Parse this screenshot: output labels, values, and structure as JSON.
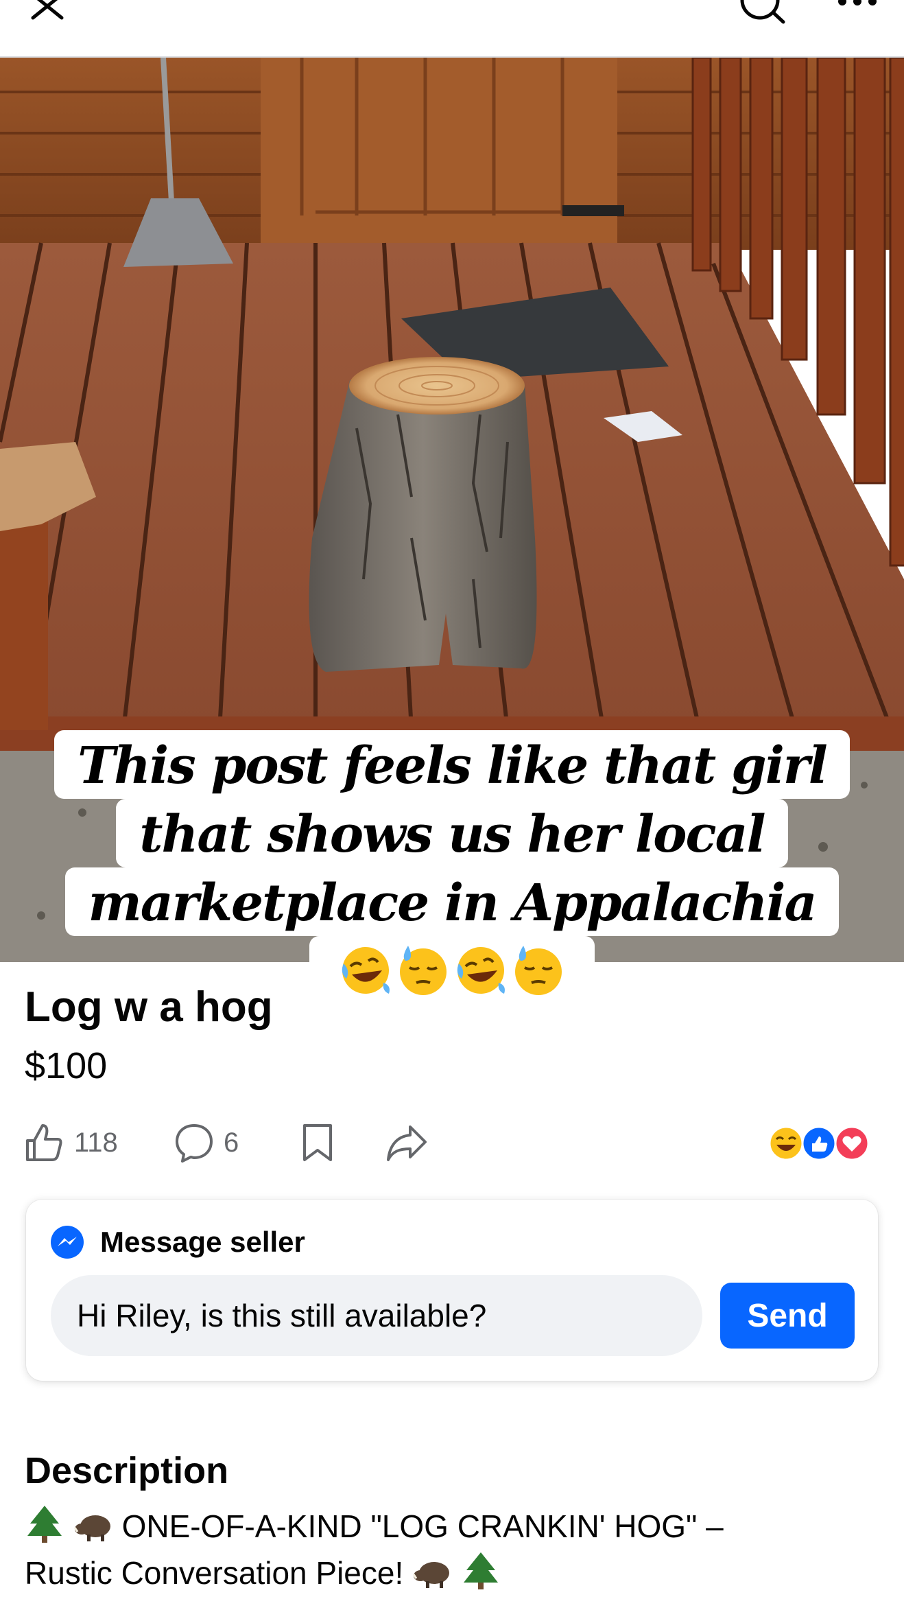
{
  "topbar": {
    "close_icon": "close-icon",
    "search_icon": "search-icon",
    "more_icon": "more-icon"
  },
  "photo": {
    "description_hidden": ""
  },
  "caption": {
    "lines": [
      "This post feels like that girl",
      "that shows us her local",
      "marketplace in Appalachia"
    ],
    "emojis": [
      "rolling-laughing",
      "sweat",
      "rolling-laughing",
      "sweat"
    ]
  },
  "listing": {
    "title": "Log w a hog",
    "price": "$100"
  },
  "actions": {
    "likes": "118",
    "comments": "6",
    "reactions": [
      "haha",
      "like",
      "love"
    ]
  },
  "message": {
    "label": "Message seller",
    "input_value": "Hi Riley, is this still available?",
    "send_label": "Send"
  },
  "description": {
    "heading": "Description",
    "line1": "ONE-OF-A-KIND \"LOG CRANKIN' HOG\" –",
    "line2": "Rustic Conversation Piece!"
  },
  "colors": {
    "accent": "#0866ff",
    "input_bg": "#f0f2f5",
    "muted": "#65676b"
  }
}
